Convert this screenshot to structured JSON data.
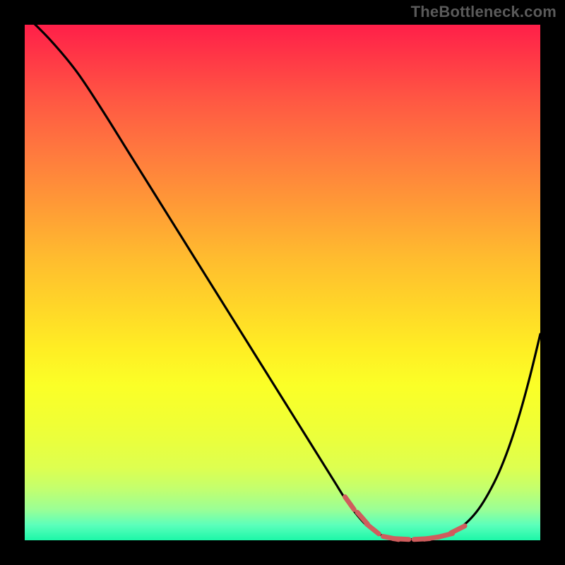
{
  "attribution": "TheBottleneck.com",
  "colors": {
    "page_bg": "#000000",
    "curve_stroke": "#000000",
    "marker_stroke": "#cf5d5d",
    "attribution_text": "#5a5a5a"
  },
  "chart_data": {
    "type": "line",
    "title": "",
    "xlabel": "",
    "ylabel": "",
    "xlim": [
      0,
      100
    ],
    "ylim": [
      0,
      100
    ],
    "grid": false,
    "legend": false,
    "series": [
      {
        "name": "bottleneck-curve",
        "x": [
          0,
          5,
          10,
          15,
          20,
          25,
          30,
          35,
          40,
          45,
          50,
          55,
          60,
          62,
          64,
          66,
          68,
          70,
          72,
          74,
          76,
          78,
          80,
          82,
          84,
          86,
          88,
          90,
          92,
          94,
          96,
          98,
          100
        ],
        "values": [
          102,
          97,
          91,
          83.5,
          75.5,
          67.5,
          59.5,
          51.5,
          43.5,
          35.5,
          27.5,
          19.5,
          11.5,
          8.3,
          5.5,
          3.2,
          1.6,
          0.7,
          0.3,
          0.2,
          0.2,
          0.3,
          0.6,
          1.1,
          2.1,
          3.7,
          6.0,
          9.2,
          13.2,
          18.3,
          24.5,
          31.8,
          40.0
        ]
      },
      {
        "name": "optimal-range-markers",
        "x": [
          63.0,
          65.5,
          67.5,
          71.0,
          73.0,
          77.0,
          79.0,
          81.5,
          84.0
        ],
        "values": [
          7.2,
          4.3,
          2.2,
          0.45,
          0.25,
          0.25,
          0.45,
          0.95,
          2.1
        ]
      }
    ]
  }
}
